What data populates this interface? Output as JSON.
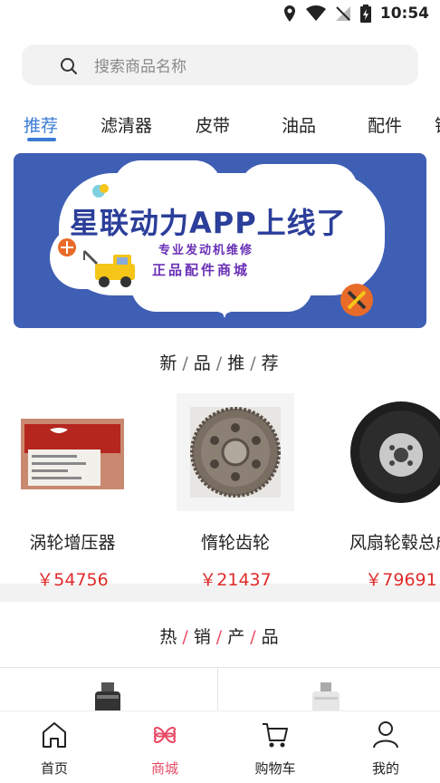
{
  "status": {
    "time": "10:54"
  },
  "search": {
    "placeholder": "搜索商品名称"
  },
  "tabs": [
    {
      "label": "推荐"
    },
    {
      "label": "滤清器"
    },
    {
      "label": "皮带"
    },
    {
      "label": "油品"
    },
    {
      "label": "配件"
    },
    {
      "label": "铝"
    }
  ],
  "banner": {
    "title": "星联动力APP上线了",
    "sub1": "专业发动机维修",
    "sub2": "正品配件商城"
  },
  "new_section": {
    "title_parts": [
      "新",
      "品",
      "推",
      "荐"
    ]
  },
  "new_products": [
    {
      "name": "涡轮增压器",
      "price": "￥54756"
    },
    {
      "name": "惰轮齿轮",
      "price": "￥21437"
    },
    {
      "name": "风扇轮毂总成",
      "price": "￥79691"
    }
  ],
  "hot_section": {
    "title_parts": [
      "热",
      "销",
      "产",
      "品"
    ]
  },
  "tabbar": [
    {
      "label": "首页",
      "icon": "home-icon"
    },
    {
      "label": "商城",
      "icon": "mall-icon"
    },
    {
      "label": "购物车",
      "icon": "cart-icon"
    },
    {
      "label": "我的",
      "icon": "user-icon"
    }
  ],
  "colors": {
    "accent": "#3a7bd5",
    "active_tab": "#e94b66",
    "price": "#e02b2b"
  }
}
